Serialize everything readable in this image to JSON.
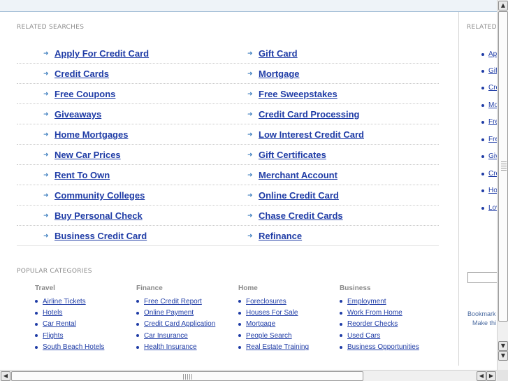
{
  "related_searches": {
    "heading": "RELATED SEARCHES",
    "rows": [
      [
        "Apply For Credit Card",
        "Gift Card"
      ],
      [
        "Credit Cards",
        "Mortgage"
      ],
      [
        "Free Coupons",
        "Free Sweepstakes"
      ],
      [
        "Giveaways",
        "Credit Card Processing"
      ],
      [
        "Home Mortgages",
        "Low Interest Credit Card"
      ],
      [
        "New Car Prices",
        "Gift Certificates"
      ],
      [
        "Rent To Own",
        "Merchant Account"
      ],
      [
        "Community Colleges",
        "Online Credit Card"
      ],
      [
        "Buy Personal Check",
        "Chase Credit Cards"
      ],
      [
        "Business Credit Card",
        "Refinance"
      ]
    ]
  },
  "popular_categories": {
    "heading": "POPULAR CATEGORIES",
    "columns": [
      {
        "title": "Travel",
        "items": [
          "Airline Tickets",
          "Hotels",
          "Car Rental",
          "Flights",
          "South Beach Hotels"
        ]
      },
      {
        "title": "Finance",
        "items": [
          "Free Credit Report",
          "Online Payment",
          "Credit Card Application",
          "Car Insurance",
          "Health Insurance"
        ]
      },
      {
        "title": "Home",
        "items": [
          "Foreclosures",
          "Houses For Sale",
          "Mortgage",
          "People Search",
          "Real Estate Training"
        ]
      },
      {
        "title": "Business",
        "items": [
          "Employment",
          "Work From Home",
          "Reorder Checks",
          "Used Cars",
          "Business Opportunities"
        ]
      }
    ]
  },
  "right_pane": {
    "heading": "RELATED",
    "items": [
      "Apply For Credit Card",
      "Gift Card",
      "Credit Cards",
      "Mortgage",
      "Free Coupons",
      "Free Sweepstakes",
      "Giveaways",
      "Credit Card Processing",
      "Home Mortgages",
      "Low Interest Credit Card"
    ],
    "items_visible": [
      "Ap",
      "Gif",
      "Cre",
      "Mo",
      "Fre",
      "Fre",
      "Giv",
      "Cre",
      "Ho",
      "Lov"
    ],
    "bookmark_text": "Bookmark",
    "make_text": "Make thi"
  },
  "scrollbar_icons": {
    "up": "▲",
    "down": "▼",
    "left": "◀",
    "right": "▶"
  },
  "colors": {
    "link": "#1f3ca6",
    "arrow": "#3f7fbf",
    "muted": "#8a8a8a"
  }
}
